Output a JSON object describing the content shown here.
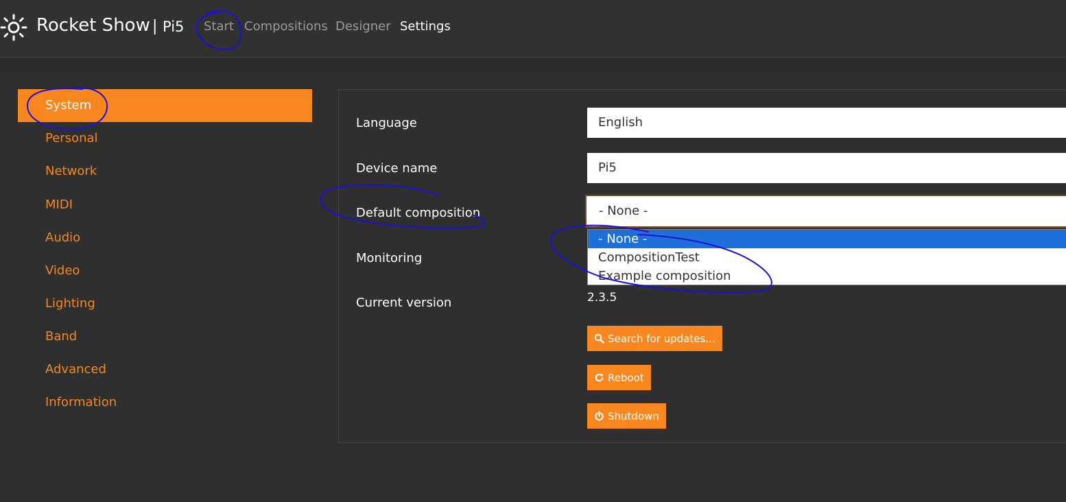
{
  "navbar": {
    "brand_name": "Rocket Show",
    "brand_separator": "|",
    "device_name": "Pi5",
    "links": [
      {
        "label": "Start",
        "active": false
      },
      {
        "label": "Compositions",
        "active": false
      },
      {
        "label": "Designer",
        "active": false
      },
      {
        "label": "Settings",
        "active": true
      }
    ]
  },
  "sidebar": {
    "items": [
      {
        "label": "System",
        "active": true
      },
      {
        "label": "Personal",
        "active": false
      },
      {
        "label": "Network",
        "active": false
      },
      {
        "label": "MIDI",
        "active": false
      },
      {
        "label": "Audio",
        "active": false
      },
      {
        "label": "Video",
        "active": false
      },
      {
        "label": "Lighting",
        "active": false
      },
      {
        "label": "Band",
        "active": false
      },
      {
        "label": "Advanced",
        "active": false
      },
      {
        "label": "Information",
        "active": false
      }
    ]
  },
  "settings": {
    "language": {
      "label": "Language",
      "value": "English"
    },
    "device_name": {
      "label": "Device name",
      "value": "Pi5"
    },
    "default_composition": {
      "label": "Default composition",
      "value": "- None -",
      "options": [
        "- None -",
        "CompositionTest",
        "Example composition"
      ],
      "highlighted_option": "- None -"
    },
    "monitoring": {
      "label": "Monitoring"
    },
    "current_version": {
      "label": "Current version",
      "value": "2.3.5"
    },
    "buttons": {
      "search_updates": "Search for updates...",
      "reboot": "Reboot",
      "shutdown": "Shutdown"
    }
  },
  "colors": {
    "accent": "#f7871e",
    "background": "#2f2f2f",
    "selection": "#1e6fd9",
    "annotation_ink": "#1a10d8"
  },
  "icons": {
    "brand": "sun-icon",
    "search_updates": "search-icon",
    "reboot": "refresh-icon",
    "shutdown": "power-icon"
  }
}
